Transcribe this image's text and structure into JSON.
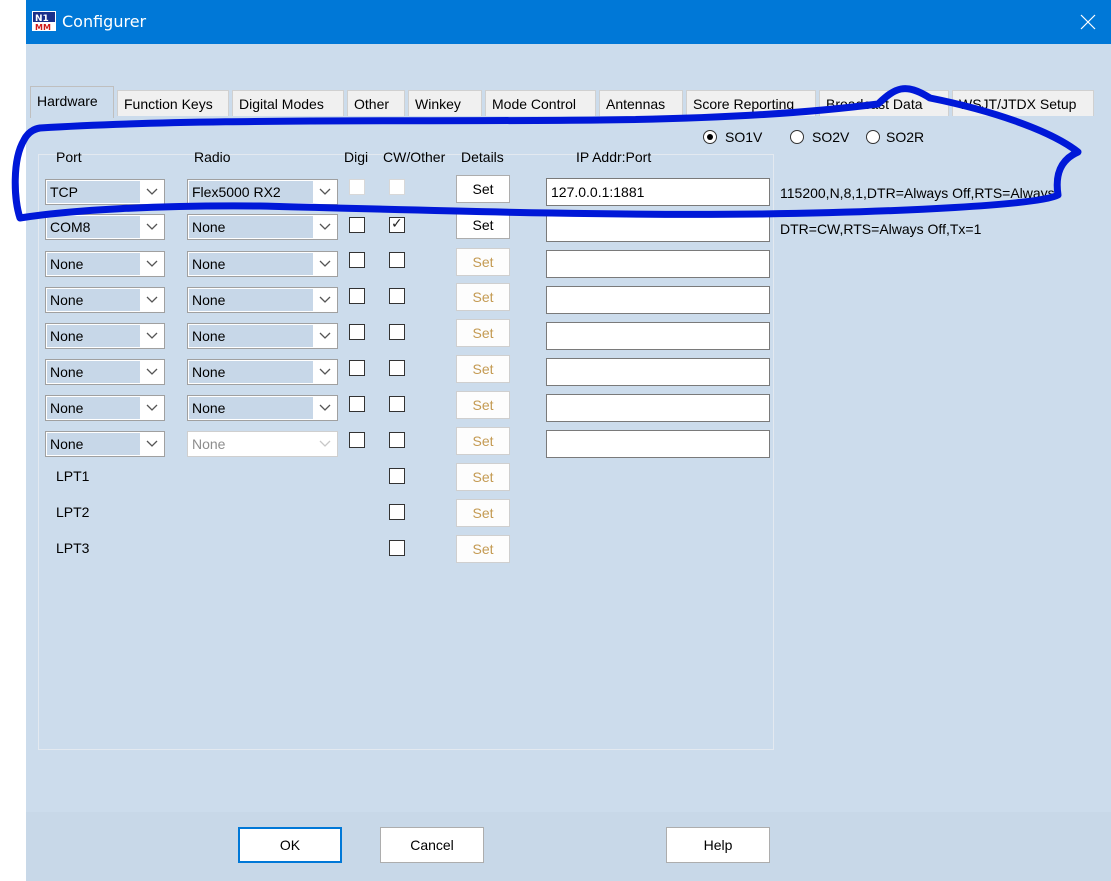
{
  "window": {
    "title": "Configurer",
    "close_icon": "close-icon",
    "app_icon": "n1mm-logo-icon",
    "accent": "#0078d7"
  },
  "tabs": [
    {
      "label": "Hardware",
      "active": true
    },
    {
      "label": "Function Keys"
    },
    {
      "label": "Digital Modes"
    },
    {
      "label": "Other"
    },
    {
      "label": "Winkey"
    },
    {
      "label": "Mode Control"
    },
    {
      "label": "Antennas"
    },
    {
      "label": "Score Reporting"
    },
    {
      "label": "Broadcast Data"
    },
    {
      "label": "WSJT/JTDX Setup"
    }
  ],
  "so_mode": {
    "options": [
      {
        "label": "SO1V",
        "checked": true
      },
      {
        "label": "SO2V",
        "checked": false
      },
      {
        "label": "SO2R",
        "checked": false
      }
    ]
  },
  "headers": {
    "port": "Port",
    "radio": "Radio",
    "digi": "Digi",
    "cw_other": "CW/Other",
    "details": "Details",
    "ip_addr": "IP Addr:Port"
  },
  "rows": [
    {
      "port": "TCP",
      "radio": "Flex5000 RX2",
      "digi": false,
      "cw": false,
      "set": "Set",
      "ip": "127.0.0.1:1881",
      "info": "115200,N,8,1,DTR=Always Off,RTS=Always"
    },
    {
      "port": "COM8",
      "radio": "None",
      "digi": false,
      "cw": true,
      "set": "Set",
      "ip": "",
      "info": "DTR=CW,RTS=Always Off,Tx=1"
    },
    {
      "port": "None",
      "radio": "None",
      "digi": false,
      "cw": false,
      "set": "Set",
      "ip": "",
      "info": ""
    },
    {
      "port": "None",
      "radio": "None",
      "digi": false,
      "cw": false,
      "set": "Set",
      "ip": "",
      "info": ""
    },
    {
      "port": "None",
      "radio": "None",
      "digi": false,
      "cw": false,
      "set": "Set",
      "ip": "",
      "info": ""
    },
    {
      "port": "None",
      "radio": "None",
      "digi": false,
      "cw": false,
      "set": "Set",
      "ip": "",
      "info": ""
    },
    {
      "port": "None",
      "radio": "None",
      "digi": false,
      "cw": false,
      "set": "Set",
      "ip": "",
      "info": ""
    },
    {
      "port": "None",
      "radio": "None",
      "digi": false,
      "cw": false,
      "set": "Set",
      "ip": "",
      "info": ""
    }
  ],
  "lpt_rows": [
    {
      "label": "LPT1",
      "cw": false,
      "set": "Set"
    },
    {
      "label": "LPT2",
      "cw": false,
      "set": "Set"
    },
    {
      "label": "LPT3",
      "cw": false,
      "set": "Set"
    }
  ],
  "buttons": {
    "ok": "OK",
    "cancel": "Cancel",
    "help": "Help"
  },
  "annotation": {
    "color": "#0018d8"
  }
}
